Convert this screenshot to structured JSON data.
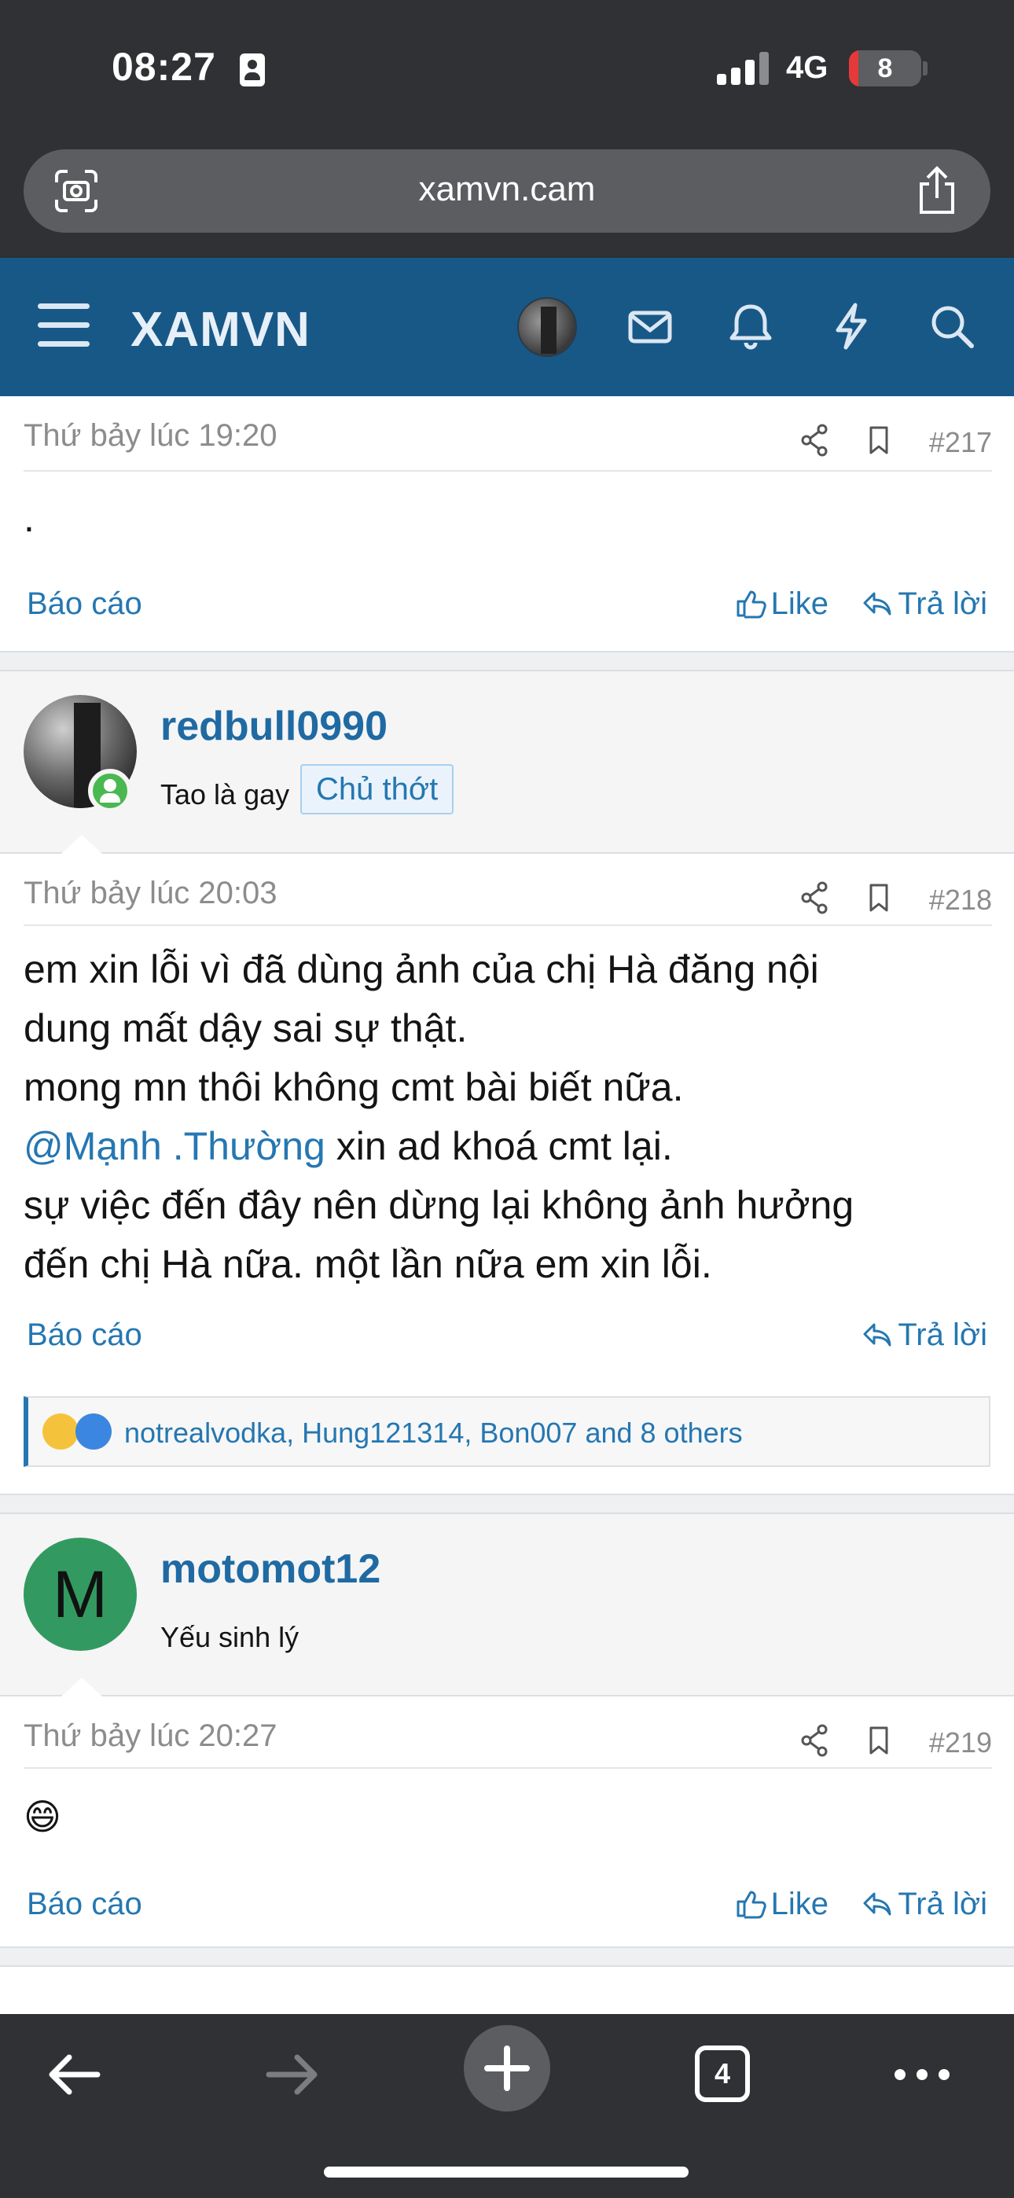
{
  "status": {
    "time": "08:27",
    "network": "4G",
    "battery": "8"
  },
  "browser": {
    "url": "xamvn.cam",
    "tab_count": "4"
  },
  "header": {
    "brand": "XAMVN"
  },
  "posts": [
    {
      "date": "Thứ bảy lúc 19:20",
      "number": "#217",
      "body": ".",
      "report": "Báo cáo",
      "like": "Like",
      "reply": "Trả lời"
    },
    {
      "user": {
        "name": "redbull0990",
        "title": "Tao là gay",
        "badge": "Chủ thớt"
      },
      "date": "Thứ bảy lúc 20:03",
      "number": "#218",
      "body_lines": [
        "em xin lỗi vì đã dùng ảnh của chị Hà đăng nội",
        "dung mất dậy sai sự thật.",
        "mong mn thôi không cmt bài biết nữa."
      ],
      "mention": "@Mạnh .Thường",
      "mention_rest": " xin ad khoá cmt lại.",
      "body_lines_2": [
        "sự việc đến đây nên dừng lại không ảnh hưởng",
        "đến chị Hà nữa. một lần nữa em xin lỗi."
      ],
      "report": "Báo cáo",
      "reply": "Trả lời",
      "reactions_text": "notrealvodka, Hung121314, Bon007 and 8 others"
    },
    {
      "user": {
        "name": "motomot12",
        "title": "Yếu sinh lý",
        "avatar_letter": "M"
      },
      "date": "Thứ bảy lúc 20:27",
      "number": "#219",
      "body_emoji": "😄",
      "report": "Báo cáo",
      "like": "Like",
      "reply": "Trả lời"
    }
  ],
  "colors": {
    "header_bg": "#185887",
    "link": "#2577b1",
    "chrome_bg": "#2f3134",
    "online": "#4ab851",
    "avatar_m": "#329a60"
  }
}
